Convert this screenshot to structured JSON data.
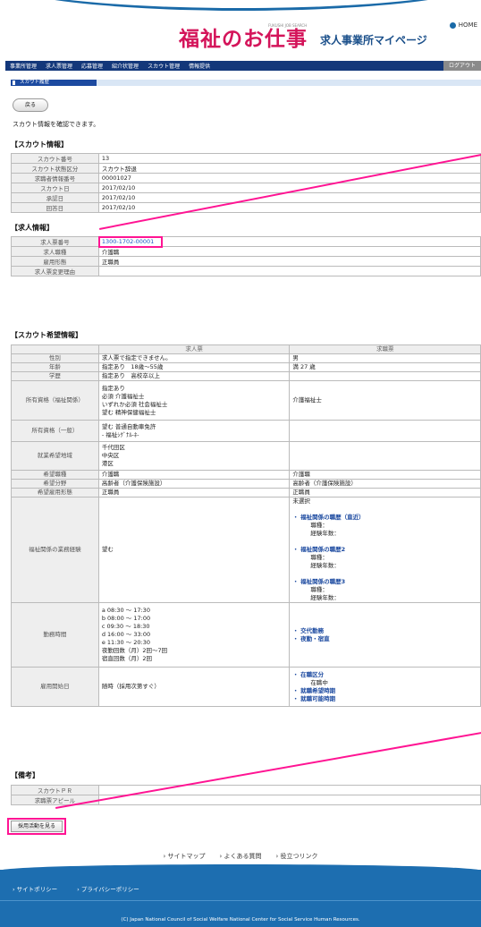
{
  "header": {
    "logo": "福祉のお仕事",
    "logo_sub": "FUKUSHI JOB SEARCH",
    "mypage": "求人事業所マイページ",
    "home": "HOME"
  },
  "nav": {
    "items": [
      "事業所管理",
      "求人票管理",
      "応募管理",
      "紹介状管理",
      "スカウト管理",
      "情報提供"
    ],
    "logout": "ログアウト"
  },
  "page": {
    "title": "スカウト履歴",
    "back": "戻る",
    "intro": "スカウト情報を確認できます。"
  },
  "scout_info": {
    "heading": "【スカウト情報】",
    "rows": [
      [
        "スカウト番号",
        "13"
      ],
      [
        "スカウト状態区分",
        "スカウト辞退"
      ],
      [
        "求職者情報番号",
        "00001027"
      ],
      [
        "スカウト日",
        "2017/02/10"
      ],
      [
        "承認日",
        "2017/02/10"
      ],
      [
        "回答日",
        "2017/02/10"
      ]
    ]
  },
  "job_info": {
    "heading": "【求人情報】",
    "rows": [
      [
        "求人票番号",
        "1300-1702-00001"
      ],
      [
        "求人職種",
        "介護職"
      ],
      [
        "雇用形態",
        "正職員"
      ],
      [
        "求人票変更理由",
        ""
      ]
    ]
  },
  "wish": {
    "heading": "【スカウト希望情報】",
    "col_job": "求人票",
    "col_seeker": "求職票",
    "rows": [
      {
        "k": "性別",
        "a": "求人票で指定できません。",
        "b": "男"
      },
      {
        "k": "年齢",
        "a": "指定あり　18歳～55歳",
        "b": "満 27 歳"
      },
      {
        "k": "学歴",
        "a": "指定あり　高校卒以上",
        "b": ""
      },
      {
        "k": "所有資格（福祉関係）",
        "a": "指定あり\n必須 介護福祉士\nいずれか必須 社会福祉士\n望む 精神保健福祉士",
        "b": "介護福祉士"
      },
      {
        "k": "所有資格（一般）",
        "a": "望む 普通自動車免許\n- 福祉ｼｸﾞﾅﾙ-ﾈ-",
        "b": ""
      },
      {
        "k": "就業希望地域",
        "a": "千代田区\n中央区\n港区",
        "b": ""
      },
      {
        "k": "希望職種",
        "a": "介護職",
        "b": "介護職"
      },
      {
        "k": "希望分野",
        "a": "高齢者（介護保険施設）",
        "b": "高齢者（介護保険施設）"
      },
      {
        "k": "希望雇用形態",
        "a": "正職員",
        "b": "正職員"
      }
    ],
    "exp": {
      "k": "福祉関係の業務経験",
      "a": "望む",
      "b_head": "未選択",
      "items": [
        {
          "t": "・ 福祉関係の職歴（直近）",
          "s": "職種：\n経験年数："
        },
        {
          "t": "・ 福祉関係の職歴2",
          "s": "職種：\n経験年数："
        },
        {
          "t": "・ 福祉関係の職歴3",
          "s": "職種：\n経験年数："
        }
      ]
    },
    "hours": {
      "k": "勤務時間",
      "a": "a 08:30 ～ 17:30\nb 08:00 ～ 17:00\nc 09:30 ～ 18:30\nd 16:00 ～ 33:00\ne 11:30 ～ 20:30\n夜勤回数（月）2回～7回\n宿直回数（月）2回",
      "b1": "・ 交代勤務",
      "b2": "・ 夜勤・宿直"
    },
    "start": {
      "k": "雇用開始日",
      "a": "随時（採用次第すぐ）",
      "b1": "・ 在職区分",
      "b1s": "在職中",
      "b2": "・ 就職希望時期",
      "b3": "・ 就職可能時期"
    }
  },
  "remarks": {
    "heading": "【備考】",
    "rows": [
      [
        "スカウトＰＲ",
        ""
      ],
      [
        "求職票アピール",
        ""
      ]
    ]
  },
  "adopt_button": "採用活動を見る",
  "footer": {
    "links": [
      "サイトマップ",
      "よくある質問",
      "役立つリンク"
    ],
    "policy": [
      "サイトポリシー",
      "プライバシーポリシー"
    ],
    "copyright": "(C) Japan National Council of Social Welfare National Center for Social Service Human Resources."
  },
  "colors": {
    "nav": "#13377a",
    "accent": "#ff1493",
    "footer": "#1d6eb0"
  }
}
